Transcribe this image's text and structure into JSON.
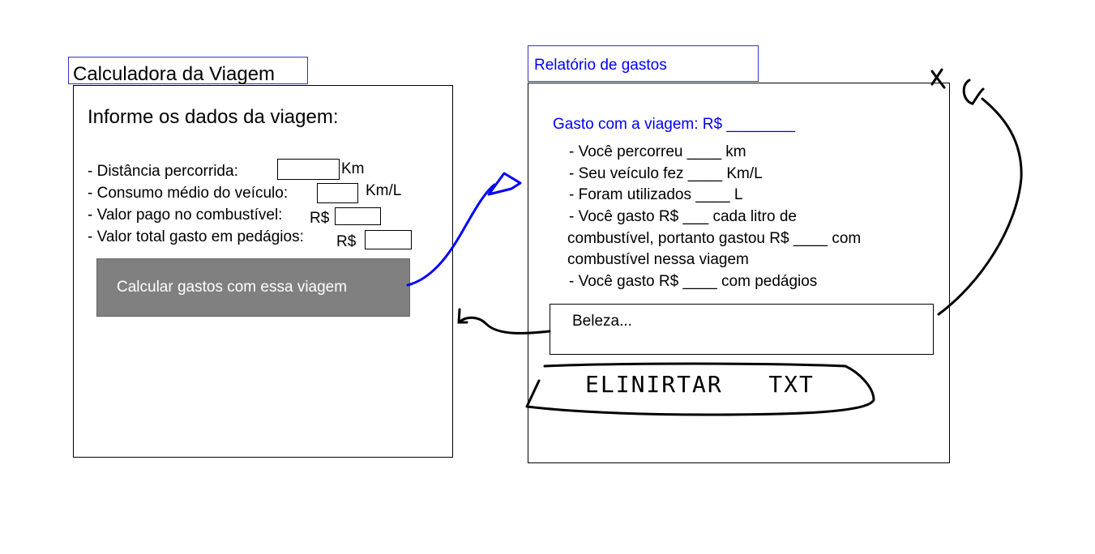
{
  "calculator": {
    "title": "Calculadora da Viagem",
    "heading": "Informe os dados da viagem:",
    "fields": [
      {
        "label": "- Distância percorrida:",
        "prefix": "",
        "unit": "Km",
        "value": ""
      },
      {
        "label": "- Consumo médio do veículo:",
        "prefix": "",
        "unit": "Km/L",
        "value": ""
      },
      {
        "label": "- Valor pago no combustível:",
        "prefix": "R$",
        "unit": "",
        "value": ""
      },
      {
        "label": "- Valor total gasto em pedágios:",
        "prefix": "R$",
        "unit": "",
        "value": ""
      }
    ],
    "button_label": "Calcular gastos com essa viagem"
  },
  "report": {
    "title": "Relatório de gastos",
    "total_line": "Gasto com a viagem: R$ ________",
    "lines": [
      " - Você percorreu ____ km",
      " - Seu veículo fez ____ Km/L",
      " - Foram utilizados ____ L",
      " - Você gasto R$ ___ cada litro de",
      "combustível, portanto gastou R$ ____ com",
      "combustível nessa viagem",
      " - Você gasto R$ ____ com pedágios"
    ],
    "comment_value": "Beleza...",
    "handwritten_button": "ELINIRTAR   TXT",
    "handwritten_x": "X"
  },
  "colors": {
    "accent_blue": "#0000ff",
    "title_border": "#3333cc",
    "button_gray": "#808080"
  }
}
